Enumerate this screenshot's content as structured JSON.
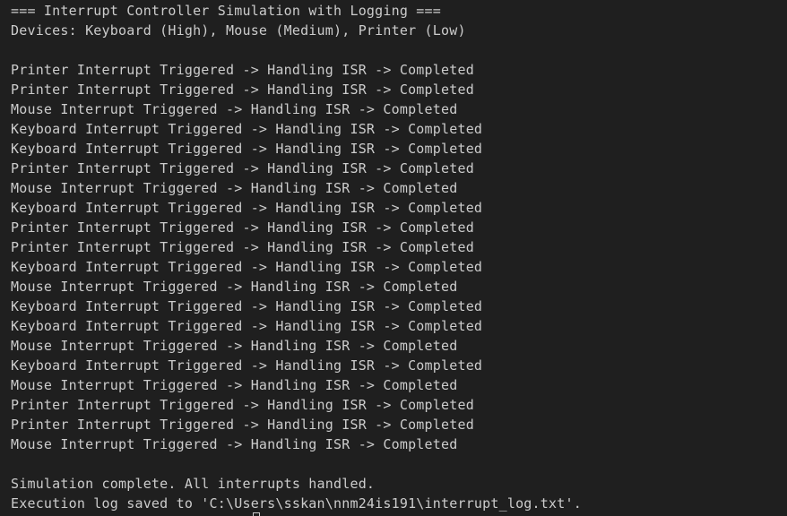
{
  "header": {
    "title": "=== Interrupt Controller Simulation with Logging ===",
    "devices": "Devices: Keyboard (High), Mouse (Medium), Printer (Low)"
  },
  "log_lines": [
    "Printer Interrupt Triggered -> Handling ISR -> Completed",
    "Printer Interrupt Triggered -> Handling ISR -> Completed",
    "Mouse Interrupt Triggered -> Handling ISR -> Completed",
    "Keyboard Interrupt Triggered -> Handling ISR -> Completed",
    "Keyboard Interrupt Triggered -> Handling ISR -> Completed",
    "Printer Interrupt Triggered -> Handling ISR -> Completed",
    "Mouse Interrupt Triggered -> Handling ISR -> Completed",
    "Keyboard Interrupt Triggered -> Handling ISR -> Completed",
    "Printer Interrupt Triggered -> Handling ISR -> Completed",
    "Printer Interrupt Triggered -> Handling ISR -> Completed",
    "Keyboard Interrupt Triggered -> Handling ISR -> Completed",
    "Mouse Interrupt Triggered -> Handling ISR -> Completed",
    "Keyboard Interrupt Triggered -> Handling ISR -> Completed",
    "Keyboard Interrupt Triggered -> Handling ISR -> Completed",
    "Mouse Interrupt Triggered -> Handling ISR -> Completed",
    "Keyboard Interrupt Triggered -> Handling ISR -> Completed",
    "Mouse Interrupt Triggered -> Handling ISR -> Completed",
    "Printer Interrupt Triggered -> Handling ISR -> Completed",
    "Printer Interrupt Triggered -> Handling ISR -> Completed",
    "Mouse Interrupt Triggered -> Handling ISR -> Completed"
  ],
  "footer": {
    "complete": "Simulation complete. All interrupts handled.",
    "log_saved": "Execution log saved to 'C:\\Users\\sskan\\nnm24is191\\interrupt_log.txt'."
  },
  "colors": {
    "background": "#1f1f1f",
    "text": "#cccccc"
  }
}
